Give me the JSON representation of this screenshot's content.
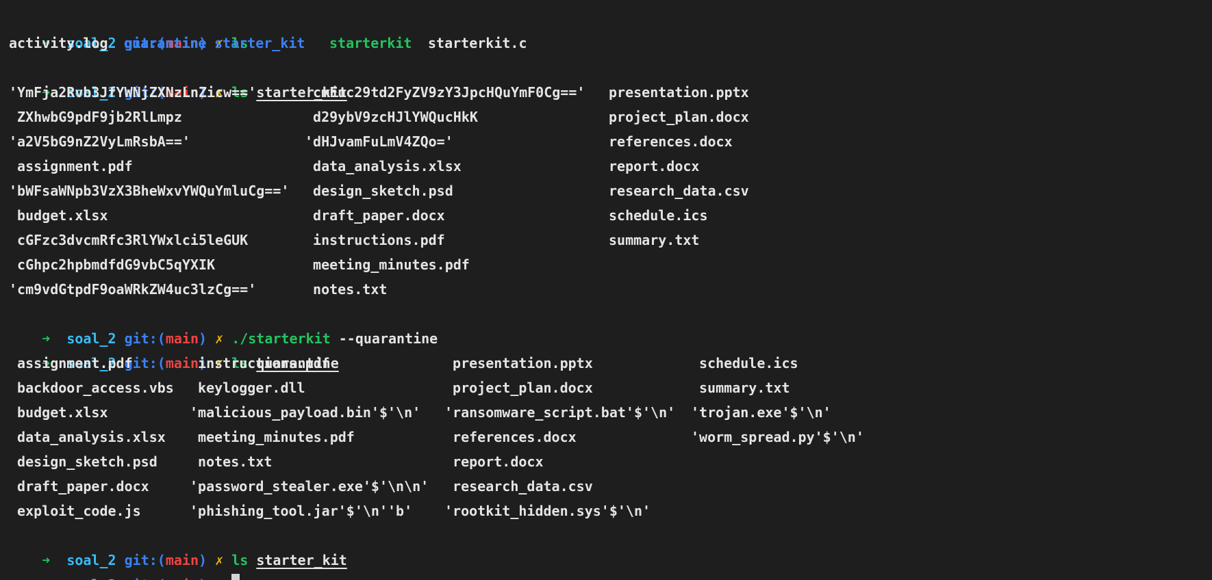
{
  "prompt": {
    "arrow": "➜",
    "dir": "soal_2",
    "git_prefix": "git:(",
    "branch": "main",
    "git_suffix": ")",
    "dirty": "✗"
  },
  "commands": {
    "c1": "ls",
    "c2_cmd": "ls",
    "c2_arg": "starter_kit",
    "c3_cmd": "./starterkit",
    "c3_arg": "--quarantine",
    "c4_cmd": "ls",
    "c4_arg": "quarantine",
    "c5_cmd": "ls",
    "c5_arg": "starter_kit"
  },
  "ls_root": [
    {
      "name": "activity.log",
      "type": "file"
    },
    {
      "name": "quarantine",
      "type": "dir"
    },
    {
      "name": "starter_kit",
      "type": "dir"
    },
    {
      "name": "starterkit",
      "type": "exec"
    },
    {
      "name": "starterkit.c",
      "type": "file"
    }
  ],
  "ls_starter_kit": {
    "col1": [
      "'YmFja2Rvb3JfYWNjZXNzLnZicw=='",
      " ZXhwbG9pdF9jb2RlLmpz",
      "'a2V5bG9nZ2VyLmRsbA=='",
      " assignment.pdf",
      "'bWFsaWNpb3VzX3BheWxvYWQuYmluCg=='",
      " budget.xlsx",
      " cGFzc3dvcmRfc3RlYWxlci5leGUK",
      " cGhpc2hpbmdfdG9vbC5qYXIK",
      "'cm9vdGtpdF9oaWRkZW4uc3lzCg=='"
    ],
    "col2": [
      "'cmFuc29td2FyZV9zY3JpcHQuYmF0Cg=='",
      " d29ybV9zcHJlYWQucHkK",
      "'dHJvamFuLmV4ZQo='",
      " data_analysis.xlsx",
      " design_sketch.psd",
      " draft_paper.docx",
      " instructions.pdf",
      " meeting_minutes.pdf",
      " notes.txt"
    ],
    "col3": [
      "presentation.pptx",
      "project_plan.docx",
      "references.docx",
      "report.docx",
      "research_data.csv",
      "schedule.ics",
      "summary.txt"
    ]
  },
  "ls_quarantine": {
    "col1": [
      " assignment.pdf",
      " backdoor_access.vbs",
      " budget.xlsx",
      " data_analysis.xlsx",
      " design_sketch.psd",
      " draft_paper.docx",
      " exploit_code.js"
    ],
    "col2": [
      " instructions.pdf",
      " keylogger.dll",
      "'malicious_payload.bin'$'\\n'",
      " meeting_minutes.pdf",
      " notes.txt",
      "'password_stealer.exe'$'\\n\\n'",
      "'phishing_tool.jar'$'\\n''b'"
    ],
    "col3": [
      " presentation.pptx",
      " project_plan.docx",
      "'ransomware_script.bat'$'\\n'",
      " references.docx",
      " report.docx",
      " research_data.csv",
      "'rootkit_hidden.sys'$'\\n'"
    ],
    "col4": [
      " schedule.ics",
      " summary.txt",
      "'trojan.exe'$'\\n'",
      "'worm_spread.py'$'\\n'"
    ]
  }
}
